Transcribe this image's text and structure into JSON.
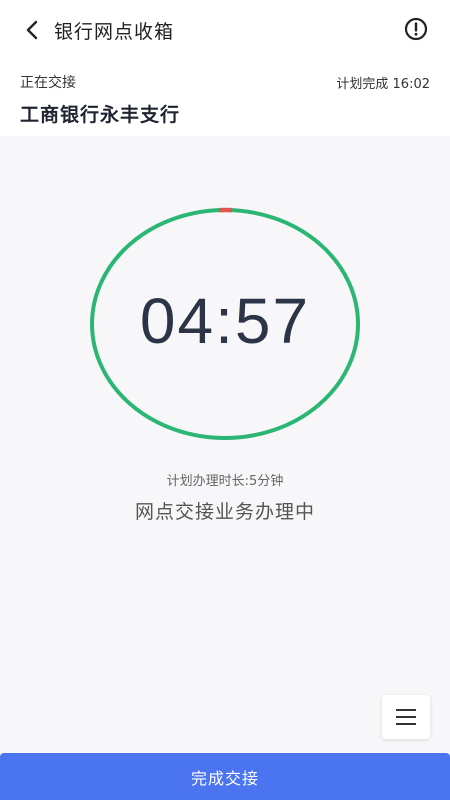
{
  "topbar": {
    "title": "银行网点收箱",
    "back_icon": "chevron-left-icon",
    "info_icon": "alert-circle-icon"
  },
  "header": {
    "status_label": "正在交接",
    "plan_finish": "计划完成 16:02",
    "branch_name": "工商银行永丰支行"
  },
  "timer": {
    "display": "04:57",
    "remaining_fraction": 0.99,
    "ring_color": "#2bb673",
    "elapsed_color": "#e0574f"
  },
  "info": {
    "plan_duration": "计划办理时长:5分钟",
    "progress_message": "网点交接业务办理中"
  },
  "menu": {
    "icon": "menu-icon"
  },
  "actions": {
    "complete_label": "完成交接",
    "primary_color": "#4a74f0"
  }
}
